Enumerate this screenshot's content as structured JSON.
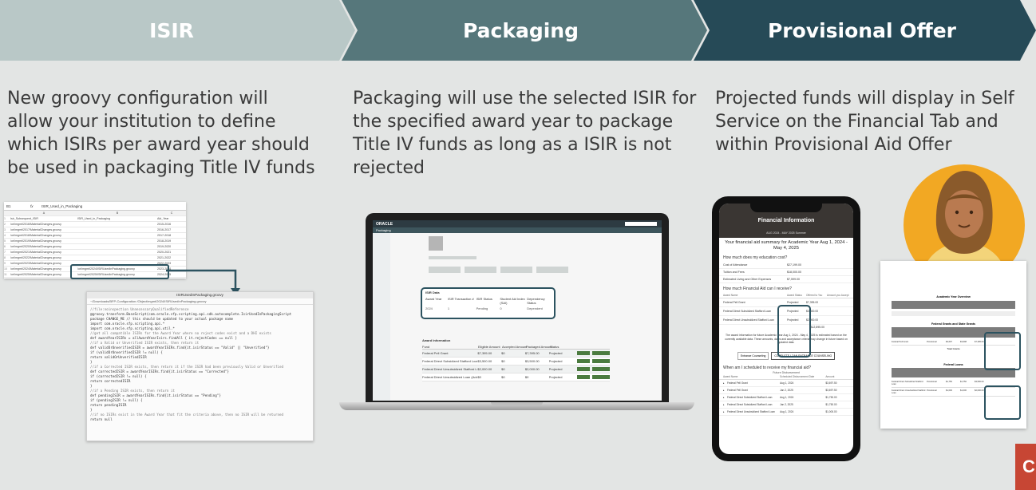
{
  "steps": [
    {
      "label": "ISIR",
      "color": "#b9c8c7"
    },
    {
      "label": "Packaging",
      "color": "#56777b"
    },
    {
      "label": "Provisional Offer",
      "color": "#264a57"
    }
  ],
  "descriptions": {
    "isir": [
      "New groovy configuration will",
      "allow your institution to define",
      "which ISIRs per award year should",
      "be used in packaging Title IV funds"
    ],
    "packaging": [
      "Packaging will use the selected ISIR for",
      "the specified award year to package",
      "Title IV funds as long as a ISIR is not",
      "rejected"
    ],
    "offer": [
      "Projected funds will display in Self",
      "Service on the Financial Tab and",
      "within Provisional Aid Offer"
    ]
  },
  "spreadsheet": {
    "cell_ref": "B1",
    "formula": "ISIR_Used_in_Packaging",
    "column_letters": [
      "A",
      "B",
      "C"
    ],
    "headers": [
      "Isir_Subsequent_ISIR",
      "ISIR_Used_in_Packaging",
      "Aid_Year"
    ],
    "rows": [
      [
        "/ori/mgmt/2016/MaterialChanges.groovy",
        "",
        "2015-2016"
      ],
      [
        "/ori/mgmt/2017/MaterialChanges.groovy",
        "",
        "2016-2017"
      ],
      [
        "/ori/mgmt/2018/MaterialChanges.groovy",
        "",
        "2017-2018"
      ],
      [
        "/ori/mgmt/2019/MaterialChanges.groovy",
        "",
        "2018-2019"
      ],
      [
        "/ori/mgmt/2020/MaterialChanges.groovy",
        "",
        "2019-2020"
      ],
      [
        "/ori/mgmt/2021/MaterialChanges.groovy",
        "",
        "2020-2021"
      ],
      [
        "/ori/mgmt/2022/MaterialChanges.groovy",
        "",
        "2021-2022"
      ],
      [
        "/ori/mgmt/2023/MaterialChanges.groovy",
        "",
        "2022-2023"
      ],
      [
        "/ori/mgmt/2024/MaterialChanges.groovy",
        "/ori/mgmt/2024/ISIRUsedInPackaging.groovy",
        "2023-2024"
      ],
      [
        "/ori/mgmt/2025/MaterialChanges.groovy",
        "/ori/mgmt/2025/ISIRUsedInPackaging.groovy",
        "2024-2025"
      ]
    ]
  },
  "code_editor": {
    "filename": "ISIRUsedInPackaging.groovy",
    "path": "~/Downloads/BFP-Configuration /Object/mgmt/2024/ISIRUsedInPackaging.groovy",
    "lines": [
      "//file:noinspection UnnecessaryQualifiedReference",
      "@groovy.transform.BaseScript(com.oracle.sfp.scripting.api.sdk.autocomplete.IsirUsedInPackagingScript",
      "package CHANGE_ME // this should be updated to your actual package name",
      "",
      "import com.oracle.sfp.scripting.api.*",
      "import com.oracle.sfp.scripting.api.util.*",
      "",
      "//get all compatible ISIRs for the Award Year where no reject codes exist and a DHI exists",
      "def awardYearISIRs = allAwardYearIsirs.findAll { it.rejectCodes == null }",
      "",
      "//if a Valid or Unverified ISIR exists, then return it",
      "def validOrUnverifiedISIR = awardYearISIRs.find{it.isirStatus == \"Valid\" || \"Unverified\"}",
      "if (validOrUnverifiedISIR != null) {",
      "    return validOrUnverifiedISIR",
      "}",
      "",
      "//if a Corrected ISIR exists, then return it if the ISIR had been previously Valid or Unverified",
      "def correctedISIR = awardYearISIRs.find{it.isirStatus == \"Corrected\"}",
      "if (correctedISIR != null) {",
      "    return correctedISIR",
      "}",
      "",
      "//if a Pending ISIR exists, then return it",
      "def pendingISIR = awardYearISIRs.find{it.isirStatus == \"Pending\"}",
      "if (pendingISIR != null) {",
      "    return pendingISIR",
      "}",
      "",
      "//if no ISIRs exist in the Award Year that fit the criteria above, then no ISIR will be returned",
      "return null"
    ]
  },
  "laptop_app": {
    "brand": "ORACLE",
    "tab": "Packaging",
    "isir_section": "ISIR Data",
    "isir_headers": [
      "Award Year",
      "ISIR Transaction #",
      "ISIR Status",
      "Student Aid Index (SAI)",
      "Dependency Status"
    ],
    "isir_row": [
      "2024",
      "1",
      "Pending",
      "0",
      "Dependent"
    ],
    "award_section": "Award Information",
    "award_headers": [
      "Fund",
      "Eligible Amount",
      "Accepted Amount",
      "Packaged Amount",
      "Status"
    ],
    "award_rows": [
      [
        "Federal Pell Grant",
        "$7,395.00",
        "$0",
        "$7,395.00",
        "Projected"
      ],
      [
        "Federal Direct Subsidized Stafford Loan",
        "$3,500.00",
        "$0",
        "$3,500.00",
        "Projected"
      ],
      [
        "Federal Direct Unsubsidized Stafford Loan",
        "$2,000.00",
        "$0",
        "$2,000.00",
        "Projected"
      ],
      [
        "Federal Direct Unsubsidized Loan (Additional Unsub)",
        "$0",
        "$0",
        "$0",
        "Projected"
      ]
    ]
  },
  "phone": {
    "header": "Financial Information",
    "subheader": "AUG 2024 - MAY 2025 Summer",
    "summary_title": "Your financial aid summary for Academic Year Aug 1, 2024 - May 4, 2025",
    "cost_question": "How much does my education cost?",
    "cost_rows": [
      [
        "Cost of Attendance",
        "$27,199.00"
      ],
      [
        "Tuition and Fees",
        "$18,000.00"
      ],
      [
        "Estimated Living and Other Expenses",
        "$7,599.00"
      ]
    ],
    "aid_question": "How much Financial Aid can I receive?",
    "aid_headers": [
      "Award Name",
      "Award Status",
      "Offered to You",
      "Amount you Accept"
    ],
    "aid_rows": [
      [
        "Federal Pell Grant",
        "Projected",
        "$7,395.00",
        ""
      ],
      [
        "Federal Direct Subsidized Stafford Loan",
        "Projected",
        "$3,500.00",
        ""
      ],
      [
        "Federal Direct Unsubsidized Stafford Loan",
        "Projected",
        "$2,000.00",
        ""
      ]
    ],
    "aid_total": "$12,895.00",
    "notice": "The award information for future Academic Year Aug 1, 2024 - May 4, 2025 is estimated based on the currently available data. These amounts, dates and acceptance criteria may change in future based on updated data.",
    "button_primary": "COMPLETE LOAN ENTRANCE COUNSELING",
    "button_secondary": "Entrance Counseling",
    "schedule_question": "When am I scheduled to receive my financial aid?",
    "schedule_title": "Future Disbursement",
    "schedule_headers": [
      "Award Name",
      "Scheduled Disbursement Date",
      "Amount"
    ],
    "schedule_rows": [
      [
        "Federal Pell Grant",
        "Aug 1, 2024",
        "$3,697.50"
      ],
      [
        "Federal Pell Grant",
        "Jan 2, 2025",
        "$3,697.50"
      ],
      [
        "Federal Direct Subsidized Stafford Loan",
        "Aug 1, 2024",
        "$1,750.00"
      ],
      [
        "Federal Direct Subsidized Stafford Loan",
        "Jan 2, 2025",
        "$1,750.00"
      ],
      [
        "Federal Direct Unsubsidized Stafford Loan",
        "Aug 1, 2024",
        "$1,000.00"
      ]
    ]
  },
  "offer_letter": {
    "overview": "Academic Year Overview",
    "grants_title": "Federal Grants and State Grants",
    "grants_rows": [
      [
        "Federal Pell Grant",
        "Provisional",
        "$3,697",
        "$3,698",
        "$7,395.00"
      ]
    ],
    "grants_total": "Total Grants",
    "loans_title": "Federal Loans",
    "loans_rows": [
      [
        "Federal Direct Subsidized Stafford Loan",
        "Provisional",
        "$1,750",
        "$1,750",
        "$3,500.00"
      ],
      [
        "Federal Direct Unsubsidized Stafford Loan",
        "Provisional",
        "$1,000",
        "$1,000",
        "$2,000.00"
      ]
    ]
  },
  "corner_logo": "C",
  "colors": {
    "background": "#e3e5e4",
    "highlight": "#2c5360",
    "oracle_red": "#c74634"
  }
}
